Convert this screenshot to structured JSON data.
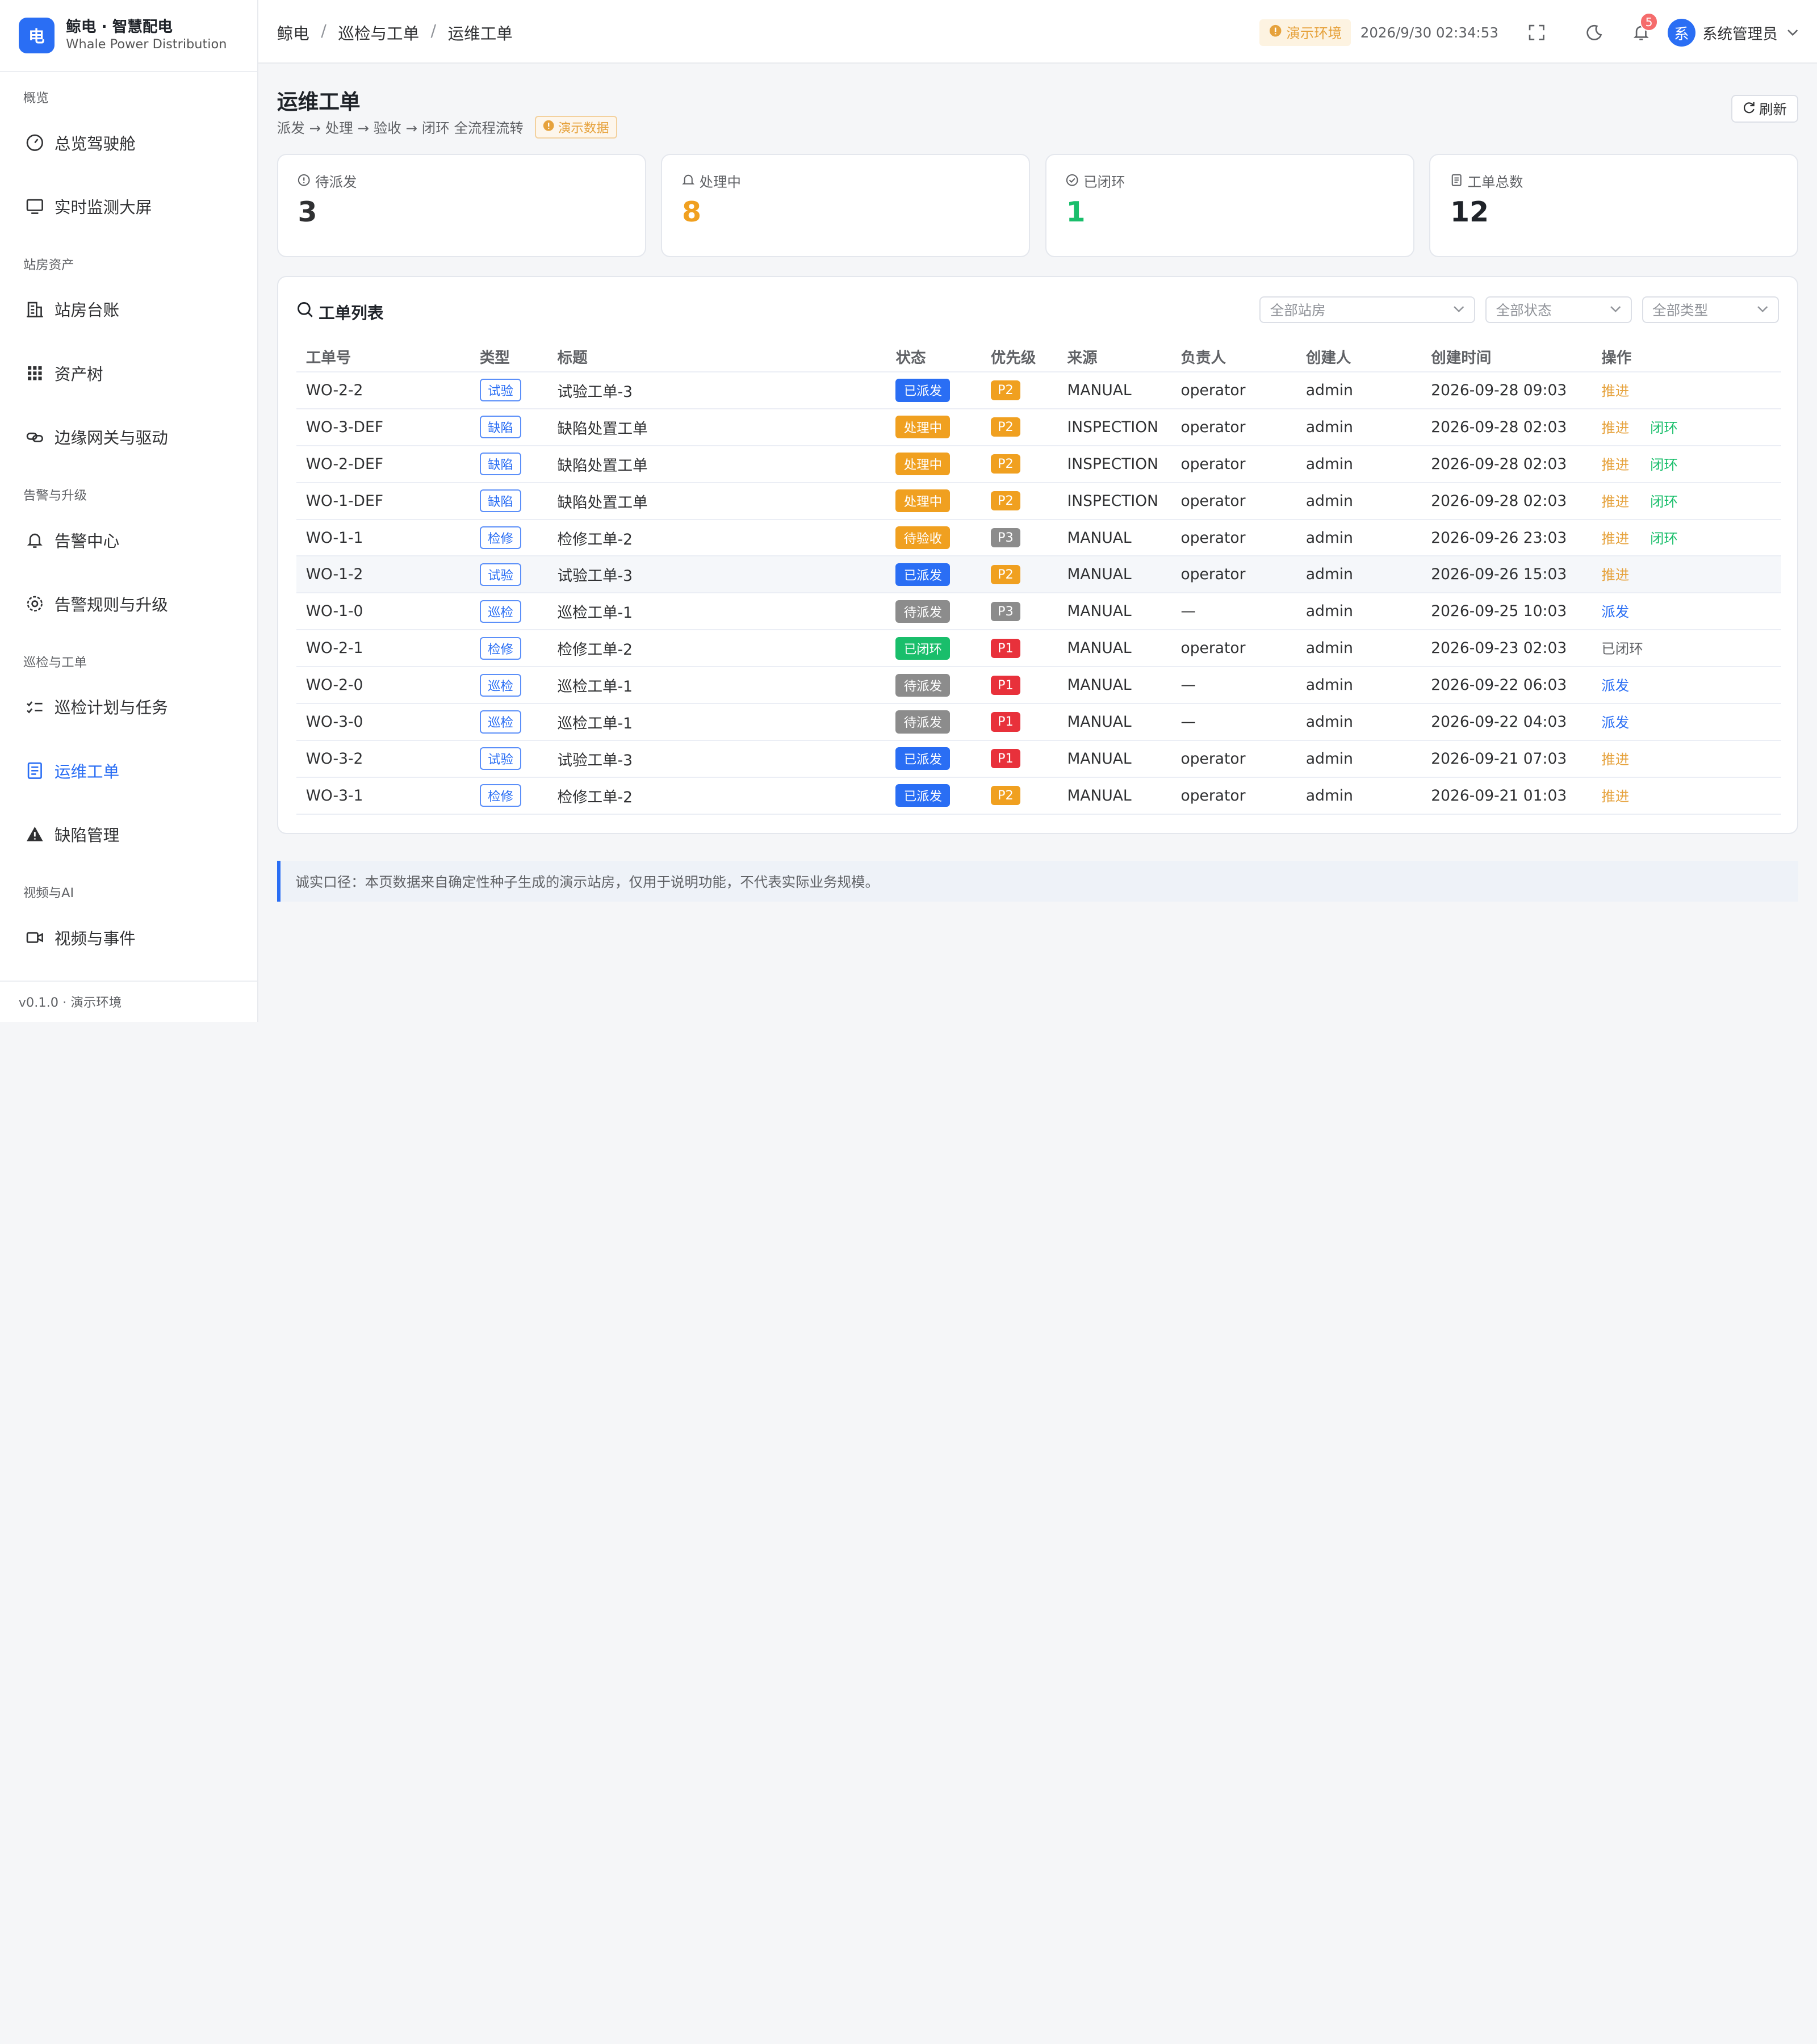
{
  "brand": {
    "logo": "电",
    "name": "鲸电 · 智慧配电",
    "sub": "Whale Power Distribution"
  },
  "nav": {
    "groups": [
      "概览",
      "站房资产",
      "告警与升级",
      "巡检与工单",
      "视频与AI"
    ],
    "items": [
      {
        "label": "总览驾驶舱",
        "icon": "gauge-icon"
      },
      {
        "label": "实时监测大屏",
        "icon": "monitor-icon"
      },
      {
        "label": "站房台账",
        "icon": "building-icon"
      },
      {
        "label": "资产树",
        "icon": "grid-icon"
      },
      {
        "label": "边缘网关与驱动",
        "icon": "link-icon"
      },
      {
        "label": "告警中心",
        "icon": "bell-icon"
      },
      {
        "label": "告警规则与升级",
        "icon": "gear-icon"
      },
      {
        "label": "巡检计划与任务",
        "icon": "checklist-icon"
      },
      {
        "label": "运维工单",
        "icon": "document-icon"
      },
      {
        "label": "缺陷管理",
        "icon": "warning-icon"
      },
      {
        "label": "视频与事件",
        "icon": "camera-icon"
      }
    ],
    "active_index": 8
  },
  "sidebar_footer": "v0.1.0 · 演示环境",
  "header": {
    "breadcrumb": [
      "鲸电",
      "巡检与工单",
      "运维工单"
    ],
    "env": "演示环境",
    "datetime": "2026/9/30 02:34:53",
    "notif_count": "5",
    "avatar": "系",
    "user": "系统管理员"
  },
  "page": {
    "title": "运维工单",
    "subtitle": "派发 → 处理 → 验收 → 闭环 全流程流转",
    "demo_tag": "演示数据",
    "refresh": "刷新"
  },
  "stats": [
    {
      "label": "待派发",
      "value": "3",
      "color": "#303133",
      "icon": "info-icon"
    },
    {
      "label": "处理中",
      "value": "8",
      "color": "#f0a020",
      "icon": "bell-icon"
    },
    {
      "label": "已闭环",
      "value": "1",
      "color": "#19be6b",
      "icon": "check-icon"
    },
    {
      "label": "工单总数",
      "value": "12",
      "color": "#1f2329",
      "icon": "doc-icon"
    }
  ],
  "panel": {
    "title": "工单列表",
    "filters": [
      "全部站房",
      "全部状态",
      "全部类型"
    ]
  },
  "table": {
    "columns": [
      "工单号",
      "类型",
      "标题",
      "状态",
      "优先级",
      "来源",
      "负责人",
      "创建人",
      "创建时间",
      "操作"
    ],
    "rows": [
      {
        "id": "WO-2-2",
        "type": "试验",
        "title": "试验工单-3",
        "status": "已派发",
        "prio": "P2",
        "source": "MANUAL",
        "owner": "operator",
        "creator": "admin",
        "time": "2026-09-28 09:03",
        "ops": [
          "推进"
        ]
      },
      {
        "id": "WO-3-DEF",
        "type": "缺陷",
        "title": "缺陷处置工单",
        "status": "处理中",
        "prio": "P2",
        "source": "INSPECTION",
        "owner": "operator",
        "creator": "admin",
        "time": "2026-09-28 02:03",
        "ops": [
          "推进",
          "闭环"
        ]
      },
      {
        "id": "WO-2-DEF",
        "type": "缺陷",
        "title": "缺陷处置工单",
        "status": "处理中",
        "prio": "P2",
        "source": "INSPECTION",
        "owner": "operator",
        "creator": "admin",
        "time": "2026-09-28 02:03",
        "ops": [
          "推进",
          "闭环"
        ]
      },
      {
        "id": "WO-1-DEF",
        "type": "缺陷",
        "title": "缺陷处置工单",
        "status": "处理中",
        "prio": "P2",
        "source": "INSPECTION",
        "owner": "operator",
        "creator": "admin",
        "time": "2026-09-28 02:03",
        "ops": [
          "推进",
          "闭环"
        ]
      },
      {
        "id": "WO-1-1",
        "type": "检修",
        "title": "检修工单-2",
        "status": "待验收",
        "prio": "P3",
        "source": "MANUAL",
        "owner": "operator",
        "creator": "admin",
        "time": "2026-09-26 23:03",
        "ops": [
          "推进",
          "闭环"
        ]
      },
      {
        "id": "WO-1-2",
        "type": "试验",
        "title": "试验工单-3",
        "status": "已派发",
        "prio": "P2",
        "source": "MANUAL",
        "owner": "operator",
        "creator": "admin",
        "time": "2026-09-26 15:03",
        "ops": [
          "推进"
        ]
      },
      {
        "id": "WO-1-0",
        "type": "巡检",
        "title": "巡检工单-1",
        "status": "待派发",
        "prio": "P3",
        "source": "MANUAL",
        "owner": "—",
        "creator": "admin",
        "time": "2026-09-25 10:03",
        "ops": [
          "派发"
        ]
      },
      {
        "id": "WO-2-1",
        "type": "检修",
        "title": "检修工单-2",
        "status": "已闭环",
        "prio": "P1",
        "source": "MANUAL",
        "owner": "operator",
        "creator": "admin",
        "time": "2026-09-23 02:03",
        "ops": [
          "已闭环"
        ]
      },
      {
        "id": "WO-2-0",
        "type": "巡检",
        "title": "巡检工单-1",
        "status": "待派发",
        "prio": "P1",
        "source": "MANUAL",
        "owner": "—",
        "creator": "admin",
        "time": "2026-09-22 06:03",
        "ops": [
          "派发"
        ]
      },
      {
        "id": "WO-3-0",
        "type": "巡检",
        "title": "巡检工单-1",
        "status": "待派发",
        "prio": "P1",
        "source": "MANUAL",
        "owner": "—",
        "creator": "admin",
        "time": "2026-09-22 04:03",
        "ops": [
          "派发"
        ]
      },
      {
        "id": "WO-3-2",
        "type": "试验",
        "title": "试验工单-3",
        "status": "已派发",
        "prio": "P1",
        "source": "MANUAL",
        "owner": "operator",
        "creator": "admin",
        "time": "2026-09-21 07:03",
        "ops": [
          "推进"
        ]
      },
      {
        "id": "WO-3-1",
        "type": "检修",
        "title": "检修工单-2",
        "status": "已派发",
        "prio": "P2",
        "source": "MANUAL",
        "owner": "operator",
        "creator": "admin",
        "time": "2026-09-21 01:03",
        "ops": [
          "推进"
        ]
      }
    ],
    "highlight_row": 5
  },
  "colors": {
    "accent": "#2a6ef4",
    "status": {
      "已派发": "#2a6ef4",
      "处理中": "#f0a020",
      "待验收": "#f0a020",
      "待派发": "#8c8c8c",
      "已闭环": "#19be6b"
    },
    "prio": {
      "P1": "#e8313b",
      "P2": "#f0a020",
      "P3": "#8c8c8c"
    }
  },
  "note": "诚实口径：本页数据来自确定性种子生成的演示站房，仅用于说明功能，不代表实际业务规模。"
}
